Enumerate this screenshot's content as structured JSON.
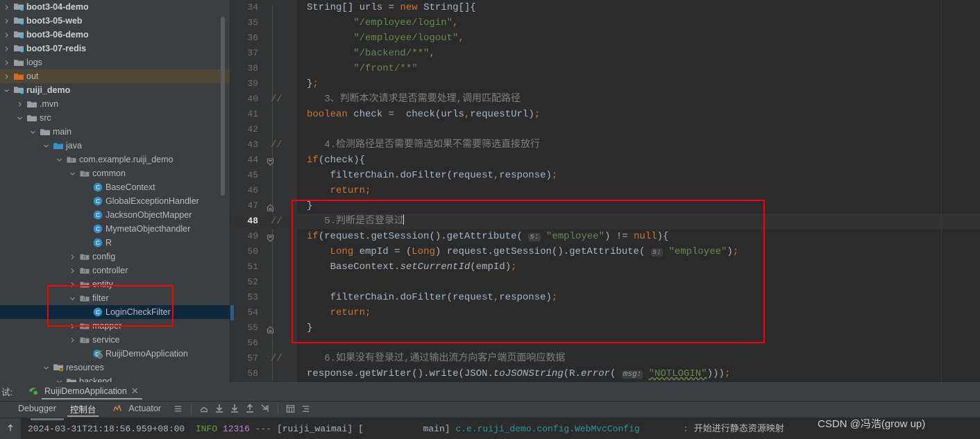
{
  "colors": {
    "accent_red": "#fb0007",
    "sidebar_bg": "#3c3f41",
    "editor_bg": "#2b2b2b",
    "selection_blue": "#0d293e",
    "selection_olive": "#4e4733"
  },
  "sidebar": {
    "name": "project-tree",
    "items": [
      {
        "label": "boot3-04-demo",
        "indent": 0,
        "arrow": "right",
        "icon": "module-folder-icon",
        "bold": true,
        "state": "none"
      },
      {
        "label": "boot3-05-web",
        "indent": 0,
        "arrow": "right",
        "icon": "module-folder-icon",
        "bold": true,
        "state": "none"
      },
      {
        "label": "boot3-06-demo",
        "indent": 0,
        "arrow": "right",
        "icon": "module-folder-icon",
        "bold": true,
        "state": "none"
      },
      {
        "label": "boot3-07-redis",
        "indent": 0,
        "arrow": "right",
        "icon": "module-folder-icon",
        "bold": true,
        "state": "none"
      },
      {
        "label": "logs",
        "indent": 0,
        "arrow": "right",
        "icon": "folder-icon",
        "bold": false,
        "state": "none"
      },
      {
        "label": "out",
        "indent": 0,
        "arrow": "right",
        "icon": "excluded-folder-icon",
        "bold": false,
        "state": "olive"
      },
      {
        "label": "ruiji_demo",
        "indent": 0,
        "arrow": "down",
        "icon": "module-folder-icon",
        "bold": true,
        "state": "none"
      },
      {
        "label": ".mvn",
        "indent": 1,
        "arrow": "right",
        "icon": "folder-icon",
        "bold": false,
        "state": "none"
      },
      {
        "label": "src",
        "indent": 1,
        "arrow": "down",
        "icon": "folder-icon",
        "bold": false,
        "state": "none"
      },
      {
        "label": "main",
        "indent": 2,
        "arrow": "down",
        "icon": "folder-icon",
        "bold": false,
        "state": "none"
      },
      {
        "label": "java",
        "indent": 3,
        "arrow": "down",
        "icon": "source-folder-icon",
        "bold": false,
        "state": "none"
      },
      {
        "label": "com.example.ruiji_demo",
        "indent": 4,
        "arrow": "down",
        "icon": "package-icon",
        "bold": false,
        "state": "none"
      },
      {
        "label": "common",
        "indent": 5,
        "arrow": "down",
        "icon": "package-icon",
        "bold": false,
        "state": "none"
      },
      {
        "label": "BaseContext",
        "indent": 6,
        "arrow": "none",
        "icon": "class-icon",
        "bold": false,
        "state": "none"
      },
      {
        "label": "GlobalExceptionHandler",
        "indent": 6,
        "arrow": "none",
        "icon": "class-icon",
        "bold": false,
        "state": "none"
      },
      {
        "label": "JacksonObjectMapper",
        "indent": 6,
        "arrow": "none",
        "icon": "class-icon",
        "bold": false,
        "state": "none"
      },
      {
        "label": "MymetaObjecthandler",
        "indent": 6,
        "arrow": "none",
        "icon": "class-icon",
        "bold": false,
        "state": "none"
      },
      {
        "label": "R",
        "indent": 6,
        "arrow": "none",
        "icon": "class-icon",
        "bold": false,
        "state": "none"
      },
      {
        "label": "config",
        "indent": 5,
        "arrow": "right",
        "icon": "package-icon",
        "bold": false,
        "state": "none"
      },
      {
        "label": "controller",
        "indent": 5,
        "arrow": "right",
        "icon": "package-icon",
        "bold": false,
        "state": "none"
      },
      {
        "label": "entity",
        "indent": 5,
        "arrow": "right",
        "icon": "package-icon",
        "bold": false,
        "state": "none"
      },
      {
        "label": "filter",
        "indent": 5,
        "arrow": "down",
        "icon": "package-icon",
        "bold": false,
        "state": "none"
      },
      {
        "label": "LoginCheckFilter",
        "indent": 6,
        "arrow": "none",
        "icon": "class-icon",
        "bold": false,
        "state": "blue"
      },
      {
        "label": "mapper",
        "indent": 5,
        "arrow": "right",
        "icon": "package-icon",
        "bold": false,
        "state": "none"
      },
      {
        "label": "service",
        "indent": 5,
        "arrow": "right",
        "icon": "package-icon",
        "bold": false,
        "state": "none"
      },
      {
        "label": "RuijiDemoApplication",
        "indent": 6,
        "arrow": "none",
        "icon": "spring-class-icon",
        "bold": false,
        "state": "none"
      },
      {
        "label": "resources",
        "indent": 3,
        "arrow": "down",
        "icon": "resources-folder-icon",
        "bold": false,
        "state": "none"
      },
      {
        "label": "backend",
        "indent": 4,
        "arrow": "down",
        "icon": "folder-icon",
        "bold": false,
        "state": "none"
      }
    ],
    "annotation_box": "red-highlight-filter-mapper"
  },
  "editor": {
    "name": "code-editor",
    "current_line": 48,
    "first_line": 34,
    "annotation_box": "red-highlight-login-check-block",
    "lines": [
      {
        "n": 34,
        "comment_marker": "",
        "fold": "",
        "accent": false,
        "text": "String[] urls = new String[]{"
      },
      {
        "n": 35,
        "comment_marker": "",
        "fold": "",
        "accent": false,
        "text": "        \"/employee/login\","
      },
      {
        "n": 36,
        "comment_marker": "",
        "fold": "",
        "accent": false,
        "text": "        \"/employee/logout\","
      },
      {
        "n": 37,
        "comment_marker": "",
        "fold": "",
        "accent": false,
        "text": "        \"/backend/**\","
      },
      {
        "n": 38,
        "comment_marker": "",
        "fold": "",
        "accent": false,
        "text": "        \"/front/**\""
      },
      {
        "n": 39,
        "comment_marker": "",
        "fold": "",
        "accent": false,
        "text": "};"
      },
      {
        "n": 40,
        "comment_marker": "//",
        "fold": "",
        "accent": false,
        "text": "   3、判断本次请求是否需要处理,调用匹配路径"
      },
      {
        "n": 41,
        "comment_marker": "",
        "fold": "",
        "accent": false,
        "text": "boolean check =  check(urls,requestUrl);"
      },
      {
        "n": 42,
        "comment_marker": "",
        "fold": "",
        "accent": false,
        "text": ""
      },
      {
        "n": 43,
        "comment_marker": "//",
        "fold": "",
        "accent": false,
        "text": "   4.检测路径是否需要筛选如果不需要筛选直接放行"
      },
      {
        "n": 44,
        "comment_marker": "",
        "fold": "minus",
        "accent": false,
        "text": "if(check){"
      },
      {
        "n": 45,
        "comment_marker": "",
        "fold": "",
        "accent": false,
        "text": "    filterChain.doFilter(request,response);"
      },
      {
        "n": 46,
        "comment_marker": "",
        "fold": "",
        "accent": false,
        "text": "    return;"
      },
      {
        "n": 47,
        "comment_marker": "",
        "fold": "end",
        "accent": false,
        "text": "}"
      },
      {
        "n": 48,
        "comment_marker": "//",
        "fold": "",
        "accent": false,
        "text": "   5.判断是否登录过"
      },
      {
        "n": 49,
        "comment_marker": "",
        "fold": "minus",
        "accent": false,
        "text": "if(request.getSession().getAttribute( s: \"employee\") != null){"
      },
      {
        "n": 50,
        "comment_marker": "",
        "fold": "",
        "accent": false,
        "text": "    Long empId = (Long) request.getSession().getAttribute( s: \"employee\");"
      },
      {
        "n": 51,
        "comment_marker": "",
        "fold": "",
        "accent": false,
        "text": "    BaseContext.setCurrentId(empId);"
      },
      {
        "n": 52,
        "comment_marker": "",
        "fold": "",
        "accent": false,
        "text": ""
      },
      {
        "n": 53,
        "comment_marker": "",
        "fold": "",
        "accent": false,
        "text": "    filterChain.doFilter(request,response);"
      },
      {
        "n": 54,
        "comment_marker": "",
        "fold": "",
        "accent": true,
        "text": "    return;"
      },
      {
        "n": 55,
        "comment_marker": "",
        "fold": "end",
        "accent": false,
        "text": "}"
      },
      {
        "n": 56,
        "comment_marker": "",
        "fold": "",
        "accent": false,
        "text": ""
      },
      {
        "n": 57,
        "comment_marker": "//",
        "fold": "",
        "accent": false,
        "text": "   6.如果没有登录过,通过输出流方向客户端页面响应数据"
      },
      {
        "n": 58,
        "comment_marker": "",
        "fold": "",
        "accent": false,
        "text": "response.getWriter().write(JSON.toJSONString(R.error( msg: \"NOTLOGIN\")));"
      }
    ],
    "inlay_hints": {
      "param_s": "s:",
      "param_msg": "msg:"
    }
  },
  "bottom_panel": {
    "name": "debug-tool-window",
    "window_label": "试:",
    "run_tab": {
      "label": "RuijiDemoApplication",
      "icon": "spring-boot-run-icon",
      "close": "✕"
    },
    "toolbar": {
      "tabs": [
        {
          "label": "Debugger",
          "active": false,
          "icon": ""
        },
        {
          "label": "控制台",
          "active": true,
          "icon": ""
        },
        {
          "label": "Actuator",
          "active": false,
          "icon": "actuator-icon"
        }
      ],
      "icons": [
        "layout-settings-icon",
        "step-over-icon",
        "step-into-icon",
        "force-step-into-icon",
        "step-out-icon",
        "run-to-cursor-icon",
        "evaluate-expression-icon",
        "mute-breakpoints-icon"
      ]
    },
    "console": {
      "scroll_to_end_icon": "scroll-up-icon",
      "lines": [
        {
          "timestamp": "2024-03-31T21:18:56.959+08:00",
          "level": "INFO",
          "pid": "12316",
          "separator": "---",
          "app": "[ruiji_waimai]",
          "thread": "[           main]",
          "logger": "c.e.ruiji_demo.config.WebMvcConfig",
          "colon": ":",
          "message": "开始进行静态资源映射"
        }
      ]
    }
  },
  "watermark": {
    "text": "CSDN @冯浩(grow up)"
  }
}
